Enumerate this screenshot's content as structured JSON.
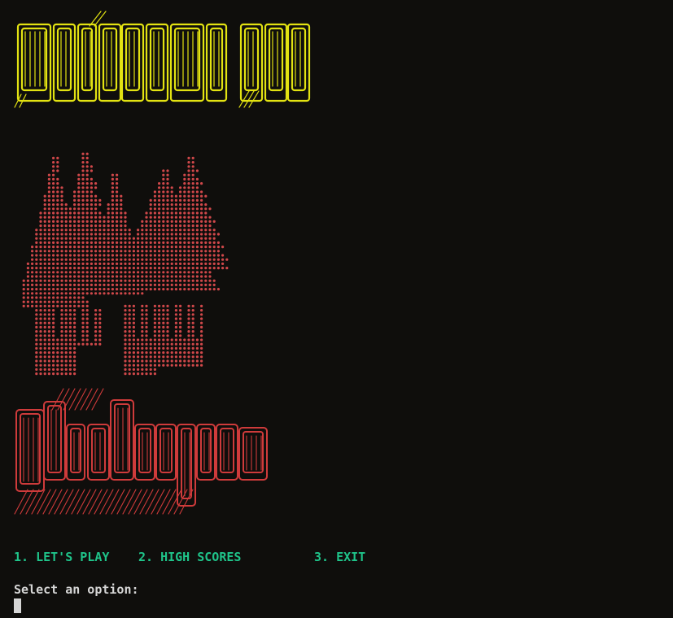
{
  "banner": {
    "welcome_text": "WELCOME TO",
    "welcome_color": "#e3e312",
    "title_text": "TheHangman",
    "title_color": "#cf3b3b",
    "trees_color": "#d0484a"
  },
  "menu": {
    "option_1": "1. LET'S PLAY",
    "option_2": "2. HIGH SCORES",
    "option_3": "3. EXIT",
    "color": "#1fc48a"
  },
  "prompt": {
    "text": "Select an option:"
  }
}
